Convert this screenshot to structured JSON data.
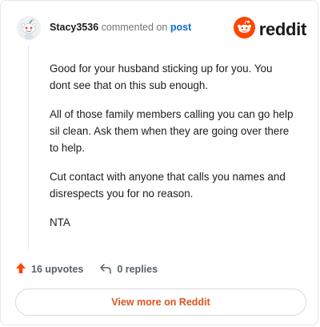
{
  "header": {
    "username": "Stacy3536",
    "commented_on": "commented on",
    "post_link": "post"
  },
  "logo": {
    "word": "reddit"
  },
  "comment": {
    "paragraphs": [
      "Good for your husband sticking up for you. You dont see that on this sub enough.",
      "All of those family members calling you can go help sil clean. Ask them when they are going over there to help.",
      "Cut contact with anyone that calls you names and disrespects you for no reason.",
      "NTA"
    ]
  },
  "actions": {
    "upvotes": "16 upvotes",
    "replies": "0 replies"
  },
  "view_more_label": "View more on Reddit",
  "colors": {
    "brand": "#ff4500",
    "link": "#0a6ec9",
    "view_more_text": "#e0531d"
  },
  "icons": {
    "avatar": "snoo-avatar-icon",
    "logo": "reddit-logo-icon",
    "upvote": "upvote-arrow-icon",
    "reply": "reply-arrow-icon"
  }
}
